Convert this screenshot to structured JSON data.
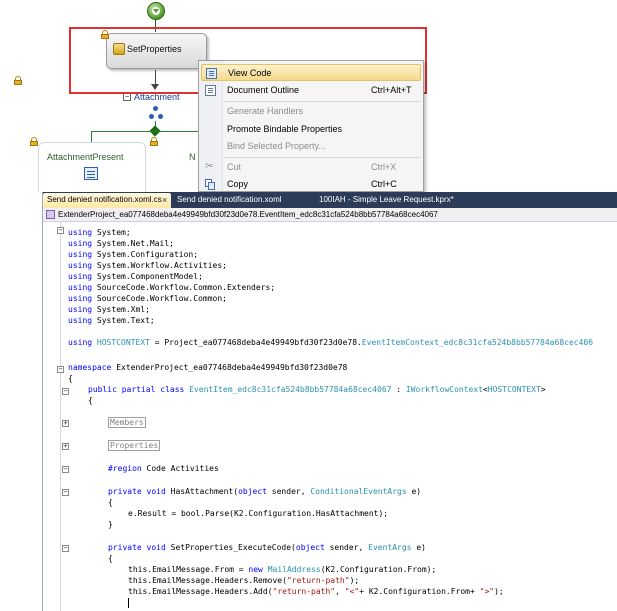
{
  "designer": {
    "activity_label": "SetProperties",
    "branch_container_label": "Attachment",
    "branch_left_label": "AttachmentPresent",
    "branch_right_label_partial": "N"
  },
  "context_menu": {
    "items": [
      {
        "label": "View Code",
        "shortcut": "",
        "enabled": true,
        "highlighted": true,
        "icon": "view-code-icon"
      },
      {
        "label": "Document Outline",
        "shortcut": "Ctrl+Alt+T",
        "enabled": true,
        "highlighted": false,
        "icon": "document-outline-icon"
      },
      {
        "label": "Generate Handlers",
        "shortcut": "",
        "enabled": false,
        "highlighted": false,
        "icon": ""
      },
      {
        "label": "Promote Bindable Properties",
        "shortcut": "",
        "enabled": true,
        "highlighted": false,
        "icon": ""
      },
      {
        "label": "Bind Selected Property...",
        "shortcut": "",
        "enabled": false,
        "highlighted": false,
        "icon": ""
      },
      {
        "label": "Cut",
        "shortcut": "Ctrl+X",
        "enabled": false,
        "highlighted": false,
        "icon": "cut-icon"
      },
      {
        "label": "Copy",
        "shortcut": "Ctrl+C",
        "enabled": true,
        "highlighted": false,
        "icon": "copy-icon"
      }
    ]
  },
  "editor": {
    "tabs": [
      {
        "label": "Send denied notification.xoml.cs",
        "active": true
      },
      {
        "label": "Send denied notification.xoml",
        "active": false
      },
      {
        "label": "100IAH - Simple Leave Request.kprx*",
        "active": false
      }
    ],
    "navbar_type": "ExtenderProject_ea077468deba4e49949bfd30f23d0e78.EventItem_edc8c31cfa524b8bb57784a68cec4067",
    "usings": [
      "System",
      "System.Net.Mail",
      "System.Configuration",
      "System.Workflow.Activities",
      "System.ComponentModel",
      "SourceCode.Workflow.Common.Extenders",
      "SourceCode.Workflow.Common",
      "System.Xml",
      "System.Text"
    ],
    "alias_name": "HOSTCONTEXT",
    "alias_ns": "Project_ea077468deba4e49949bfd30f23d0e78.",
    "alias_type": "EventItemContext_edc8c31cfa524b8bb57784a68cec406",
    "namespace_name": "ExtenderProject_ea077468deba4e49949bfd30f23d0e78",
    "class_name": "EventItem_edc8c31cfa524b8bb57784a68cec4067",
    "interface_name": "IWorkflowContext",
    "interface_arg": "HOSTCONTEXT",
    "region_members": "Members",
    "region_properties": "Properties",
    "region_code_activities": "Code Activities",
    "method1_name": "HasAttachment",
    "method1_argtype": "ConditionalEventArgs",
    "method1_body": "e.Result = bool.Parse(K2.Configuration.HasAttachment);",
    "method2_name": "SetProperties_ExecuteCode",
    "method2_argtype": "EventArgs",
    "line_from_pre": "this.EmailMessage.From = ",
    "line_from_type": "MailAddress",
    "line_from_post": "(K2.Configuration.From);",
    "line_remove_pre": "this.EmailMessage.Headers.Remove(",
    "line_remove_str": "\"return-path\"",
    "line_add_pre": "this.EmailMessage.Headers.Add(",
    "line_add_str1": "\"return-path\"",
    "line_add_str2": "\"<\"",
    "line_add_mid": "+ K2.Configuration.From+ ",
    "line_add_str3": "\">\""
  }
}
